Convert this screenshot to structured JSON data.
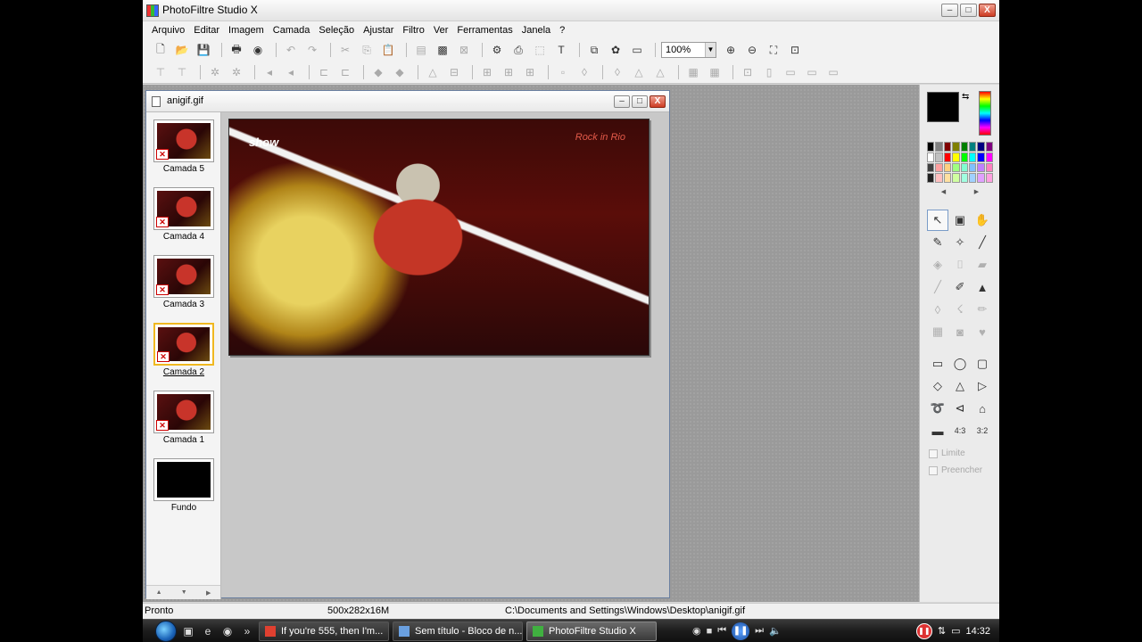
{
  "app": {
    "title": "PhotoFiltre Studio X",
    "window_buttons": {
      "minimize": "–",
      "maximize": "□",
      "close": "X"
    }
  },
  "menu": [
    "Arquivo",
    "Editar",
    "Imagem",
    "Camada",
    "Seleção",
    "Ajustar",
    "Filtro",
    "Ver",
    "Ferramentas",
    "Janela",
    "?"
  ],
  "toolbar": {
    "zoom_value": "100%",
    "zoom_arrow": "▼",
    "icons_row1": [
      "new-file-icon",
      "open-file-icon",
      "save-icon",
      "print-icon",
      "scan-icon",
      "undo-icon",
      "redo-icon",
      "cut-icon",
      "copy-icon",
      "paste-icon",
      "image-icon",
      "rgb-icon",
      "transparency-icon",
      "automate-icon",
      "text-layer-icon",
      "text-icon",
      "selection-icon",
      "layers-icon",
      "window-icon"
    ],
    "icons_zoom": [
      "zoom-in-icon",
      "zoom-out-icon",
      "fit-image-icon",
      "fullscreen-icon"
    ],
    "row2_glyphs": [
      "⊤",
      "⊤",
      "✲",
      "✲",
      "◂",
      "◂",
      "⊏",
      "⊏",
      "◆",
      "◆",
      "△",
      "⊟",
      "⊞",
      "⊞",
      "⊞",
      "▫",
      "◊",
      "◊",
      "△",
      "△",
      "▦",
      "▦",
      "⊡",
      "▯",
      "▭",
      "▭",
      "▭"
    ]
  },
  "document": {
    "name": "anigif.gif",
    "canvas_logo_left": "show",
    "canvas_logo_right": "Rock in Rio"
  },
  "layers": [
    {
      "name": "Camada 5",
      "selected": false
    },
    {
      "name": "Camada 4",
      "selected": false
    },
    {
      "name": "Camada 3",
      "selected": false
    },
    {
      "name": "Camada 2",
      "selected": true
    },
    {
      "name": "Camada 1",
      "selected": false
    },
    {
      "name": "Fundo",
      "selected": false
    }
  ],
  "palette_colors": [
    "#000000",
    "#808080",
    "#800000",
    "#808000",
    "#008000",
    "#008080",
    "#000080",
    "#800080",
    "#ffffff",
    "#c0c0c0",
    "#ff0000",
    "#ffff00",
    "#00ff00",
    "#00ffff",
    "#0000ff",
    "#ff00ff",
    "#404040",
    "#ffa0a0",
    "#ffd080",
    "#a0ff80",
    "#80ffd0",
    "#80c0ff",
    "#c080ff",
    "#ff80c0",
    "#202020",
    "#ffc0c0",
    "#ffe0a0",
    "#d0ffa0",
    "#a0ffe0",
    "#a0d0ff",
    "#e0a0ff",
    "#ffa0e0"
  ],
  "tools": [
    {
      "icon": "pointer-icon",
      "glyph": "↖",
      "active": true
    },
    {
      "icon": "layer-select-icon",
      "glyph": "▣",
      "active": false
    },
    {
      "icon": "hand-icon",
      "glyph": "✋",
      "active": false
    },
    {
      "icon": "eyedropper-icon",
      "glyph": "✎",
      "active": false
    },
    {
      "icon": "magic-wand-icon",
      "glyph": "✧",
      "active": false
    },
    {
      "icon": "line-icon",
      "glyph": "╱",
      "active": false
    },
    {
      "icon": "fill-icon",
      "glyph": "◈",
      "active": false,
      "dim": true
    },
    {
      "icon": "spray-icon",
      "glyph": "⌷",
      "active": false,
      "dim": true
    },
    {
      "icon": "eraser-icon",
      "glyph": "▰",
      "active": false,
      "dim": true
    },
    {
      "icon": "brush-icon",
      "glyph": "╱",
      "active": false,
      "dim": true
    },
    {
      "icon": "advanced-brush-icon",
      "glyph": "✐",
      "active": false
    },
    {
      "icon": "stamp-icon",
      "glyph": "▲",
      "active": false
    },
    {
      "icon": "blur-icon",
      "glyph": "◊",
      "active": false,
      "dim": true
    },
    {
      "icon": "smudge-icon",
      "glyph": "☇",
      "active": false,
      "dim": true
    },
    {
      "icon": "pencil-icon",
      "glyph": "✏",
      "active": false,
      "dim": true
    },
    {
      "icon": "clone-icon",
      "glyph": "▦",
      "active": false,
      "dim": true
    },
    {
      "icon": "distort-icon",
      "glyph": "◙",
      "active": false,
      "dim": true
    },
    {
      "icon": "heart-icon",
      "glyph": "♥",
      "active": false,
      "dim": true
    }
  ],
  "shapes": [
    {
      "icon": "rectangle-icon",
      "glyph": "▭"
    },
    {
      "icon": "ellipse-icon",
      "glyph": "◯"
    },
    {
      "icon": "rounded-rect-icon",
      "glyph": "▢"
    },
    {
      "icon": "diamond-icon",
      "glyph": "◇"
    },
    {
      "icon": "triangle-icon",
      "glyph": "△"
    },
    {
      "icon": "right-triangle-icon",
      "glyph": "▷"
    },
    {
      "icon": "lasso-icon",
      "glyph": "➰"
    },
    {
      "icon": "polygon-icon",
      "glyph": "⊲"
    },
    {
      "icon": "open-selection-icon",
      "glyph": "⌂"
    },
    {
      "icon": "fit-selection-icon",
      "glyph": "▬"
    },
    {
      "icon": "ratio-4-3-icon",
      "glyph": "4:3"
    },
    {
      "icon": "ratio-3-2-icon",
      "glyph": "3:2"
    }
  ],
  "options": {
    "limit": "Limite",
    "fill": "Preencher"
  },
  "status": {
    "state": "Pronto",
    "dimensions": "500x282x16M",
    "path": "C:\\Documents and Settings\\Windows\\Desktop\\anigif.gif"
  },
  "taskbar": {
    "tasks": [
      {
        "label": "If you're 555, then I'm...",
        "active": false,
        "color": "#e04030"
      },
      {
        "label": "Sem título - Bloco de n...",
        "active": false,
        "color": "#6aa0e0"
      },
      {
        "label": "PhotoFiltre Studio X",
        "active": true,
        "color": "#40b040"
      }
    ],
    "clock": "14:32"
  }
}
